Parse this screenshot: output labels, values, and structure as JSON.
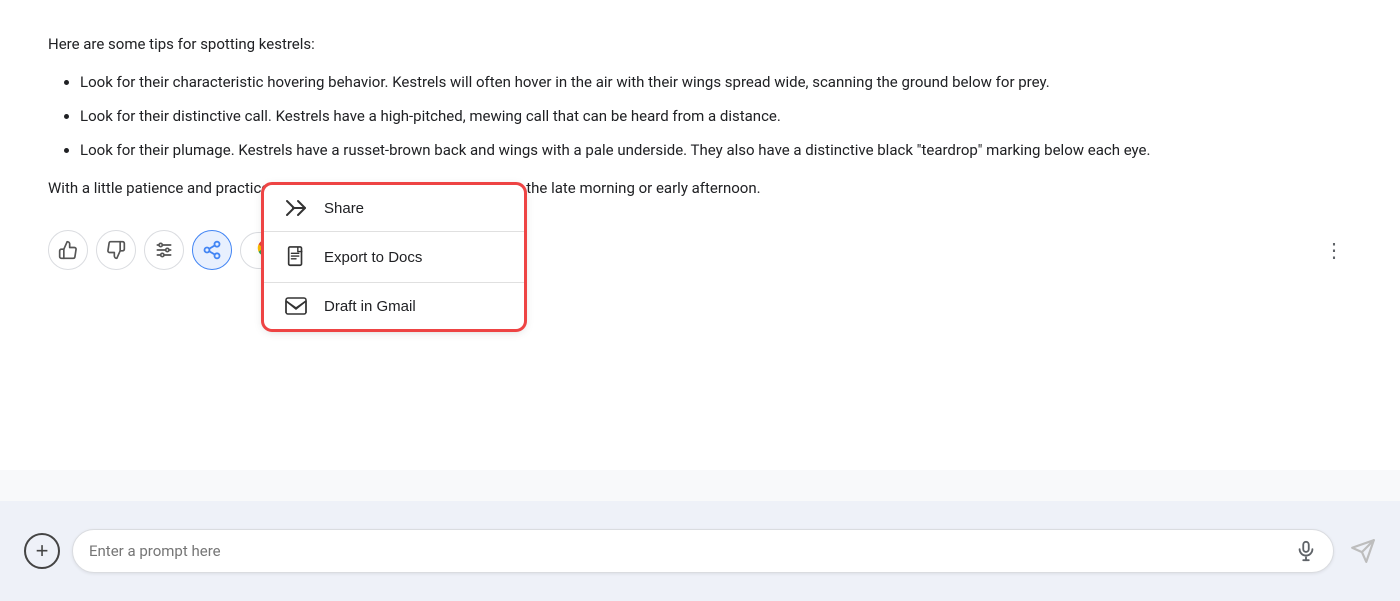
{
  "content": {
    "intro": "Here are some tips for spotting kestrels:",
    "bullets": [
      "Look for their characteristic hovering behavior. Kestrels will often hover in the air with their wings spread wide, scanning the ground below for prey.",
      "Look for their distinctive call. Kestrels have a high-pitched, mewing call that can be heard from a distance.",
      "Look for their plumage. Kestrels have a russet-brown back and wings with a pale underside. They also have a distinctive black \"teardrop\" marking below each eye."
    ],
    "closing": "With a little patience and practice, you should be able to spot kestrels in the late morning or early afternoon."
  },
  "context_menu": {
    "items": [
      {
        "id": "share",
        "label": "Share",
        "icon": "share"
      },
      {
        "id": "export-docs",
        "label": "Export to Docs",
        "icon": "docs"
      },
      {
        "id": "draft-gmail",
        "label": "Draft in Gmail",
        "icon": "gmail"
      }
    ]
  },
  "toolbar": {
    "thumbs_up_label": "👍",
    "thumbs_down_label": "👎",
    "adjust_label": "⊞",
    "share_label": "share",
    "google_it_label": "Google it",
    "more_label": "⋮"
  },
  "bottom_bar": {
    "add_label": "+",
    "prompt_placeholder": "Enter a prompt here"
  }
}
